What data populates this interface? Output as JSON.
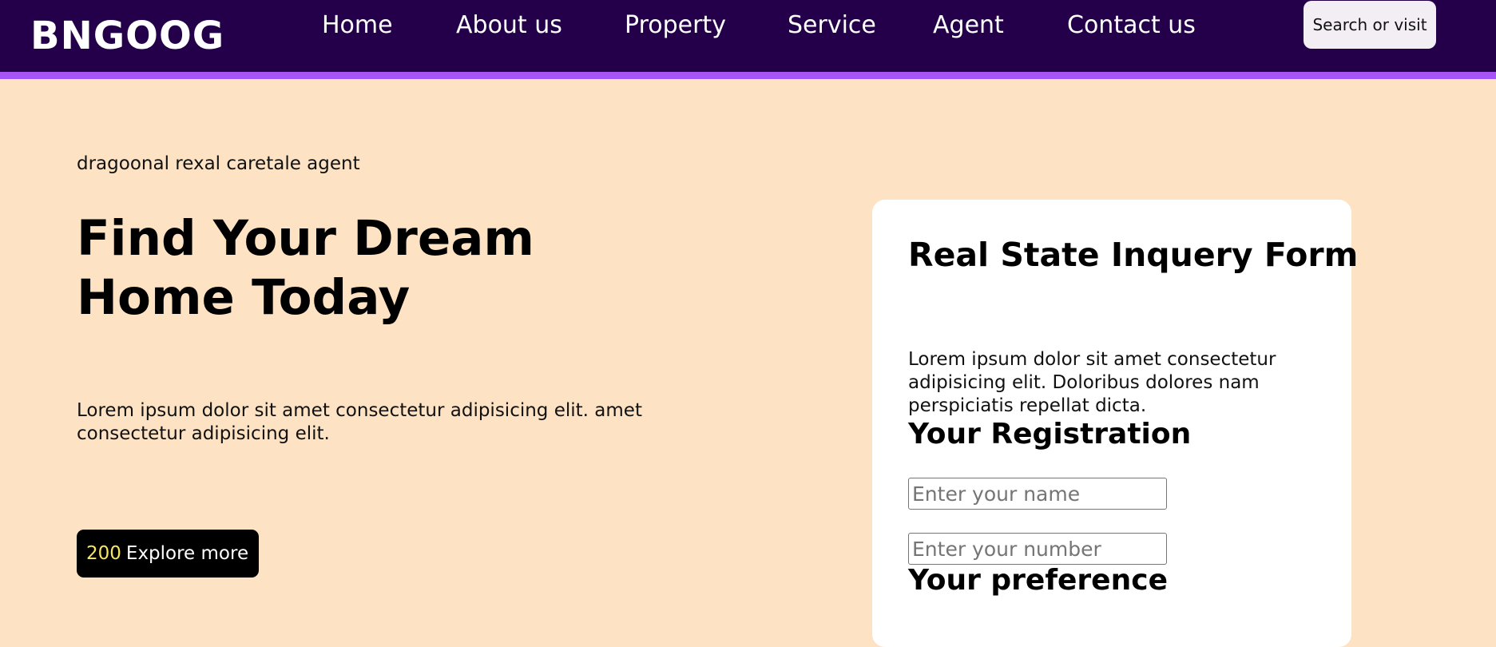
{
  "navbar": {
    "logo": "BNGOOG",
    "links": [
      {
        "label": "Home"
      },
      {
        "label": "About us"
      },
      {
        "label": "Property"
      },
      {
        "label": "Service"
      },
      {
        "label": "Agent"
      },
      {
        "label": "Contact us"
      }
    ],
    "search_text": "Search or visit"
  },
  "hero": {
    "tagline": "dragoonal rexal caretale agent",
    "title": "Find Your Dream Home Today",
    "text": "Lorem ipsum dolor sit amet consectetur adipisicing elit. amet consectetur adipisicing elit.",
    "button_count": "200",
    "button_label": "Explore more"
  },
  "form": {
    "title": "Real State Inquery Form",
    "description": "Lorem ipsum dolor sit amet consectetur adipisicing elit. Doloribus dolores nam perspiciatis repellat dicta.",
    "registration_heading": "Your Registration",
    "name_placeholder": "Enter your name",
    "number_placeholder": "Enter your number",
    "preference_heading": "Your preference"
  },
  "colors": {
    "navbar_bg": "#24004a",
    "navbar_border": "#a855f7",
    "page_bg": "#fde3c4",
    "button_count": "#f5e663"
  }
}
